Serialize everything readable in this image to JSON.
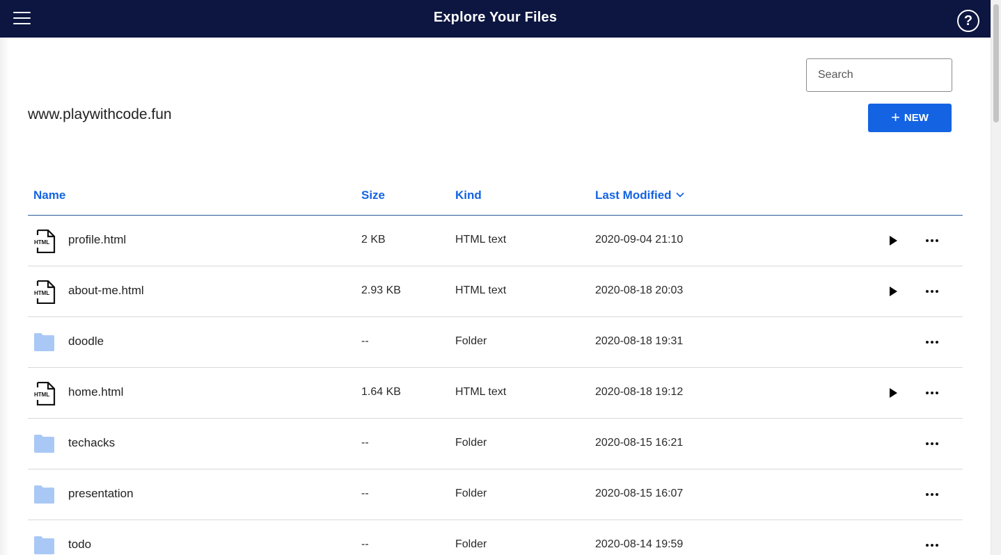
{
  "header": {
    "title": "Explore Your Files",
    "help_label": "?"
  },
  "search": {
    "placeholder": "Search"
  },
  "site_title": "www.playwithcode.fun",
  "new_button": {
    "icon": "+",
    "label": "NEW"
  },
  "columns": {
    "name": "Name",
    "size": "Size",
    "kind": "Kind",
    "modified": "Last Modified",
    "sort_indicator": "chevron-down-icon"
  },
  "files": [
    {
      "name": "profile.html",
      "size": "2 KB",
      "kind": "HTML text",
      "modified": "2020-09-04 21:10",
      "type": "html",
      "playable": true
    },
    {
      "name": "about-me.html",
      "size": "2.93 KB",
      "kind": "HTML text",
      "modified": "2020-08-18 20:03",
      "type": "html",
      "playable": true
    },
    {
      "name": "doodle",
      "size": "--",
      "kind": "Folder",
      "modified": "2020-08-18 19:31",
      "type": "folder",
      "playable": false
    },
    {
      "name": "home.html",
      "size": "1.64 KB",
      "kind": "HTML text",
      "modified": "2020-08-18 19:12",
      "type": "html",
      "playable": true
    },
    {
      "name": "techacks",
      "size": "--",
      "kind": "Folder",
      "modified": "2020-08-15 16:21",
      "type": "folder",
      "playable": false
    },
    {
      "name": "presentation",
      "size": "--",
      "kind": "Folder",
      "modified": "2020-08-15 16:07",
      "type": "folder",
      "playable": false
    },
    {
      "name": "todo",
      "size": "--",
      "kind": "Folder",
      "modified": "2020-08-14 19:59",
      "type": "folder",
      "playable": false
    }
  ],
  "icons": {
    "html_file": "html-file-icon",
    "folder": "folder-icon",
    "play": "play-icon",
    "more": "more-icon"
  },
  "colors": {
    "header_bg": "#0c1640",
    "accent": "#1463e3",
    "folder": "#a9c8f5"
  }
}
